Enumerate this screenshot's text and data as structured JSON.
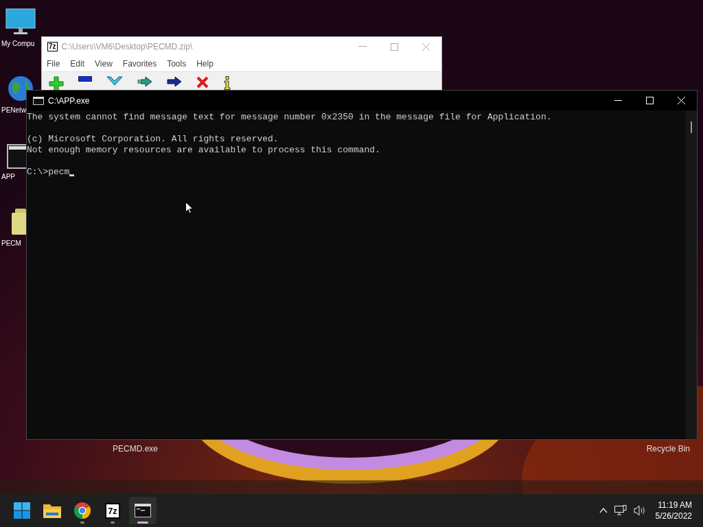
{
  "desktop_icons": [
    {
      "label": "My Compu",
      "kind": "monitor"
    },
    {
      "label": "PENetw",
      "kind": "globe"
    },
    {
      "label": "APP",
      "kind": "console"
    },
    {
      "label": "PECM",
      "kind": "archive"
    }
  ],
  "desktop_labels": [
    "PECMD.exe",
    "Recycle Bin"
  ],
  "archive_window": {
    "icon_label": "7z",
    "title": "C:\\Users\\VM6\\Desktop\\PECMD.zip\\",
    "menu": [
      "File",
      "Edit",
      "View",
      "Favorites",
      "Tools",
      "Help"
    ]
  },
  "console_window": {
    "title": "C:\\APP.exe",
    "paragraphs": [
      [
        "The system cannot find message text for message number 0x2350 in the message file for Application."
      ],
      [
        "(c) Microsoft Corporation. All rights reserved.",
        "Not enough memory resources are available to process this command."
      ]
    ],
    "prompt": "C:\\>pecm"
  },
  "taskbar": {
    "apps": [
      {
        "kind": "start",
        "running": false,
        "selected": false
      },
      {
        "kind": "folder",
        "running": false,
        "selected": false
      },
      {
        "kind": "browser",
        "running": true,
        "selected": false
      },
      {
        "kind": "sevenzip",
        "label": "7z",
        "running": true,
        "selected": false
      },
      {
        "kind": "console",
        "running": true,
        "selected": true
      }
    ],
    "time": "11:19 AM",
    "date": "5/26/2022"
  }
}
